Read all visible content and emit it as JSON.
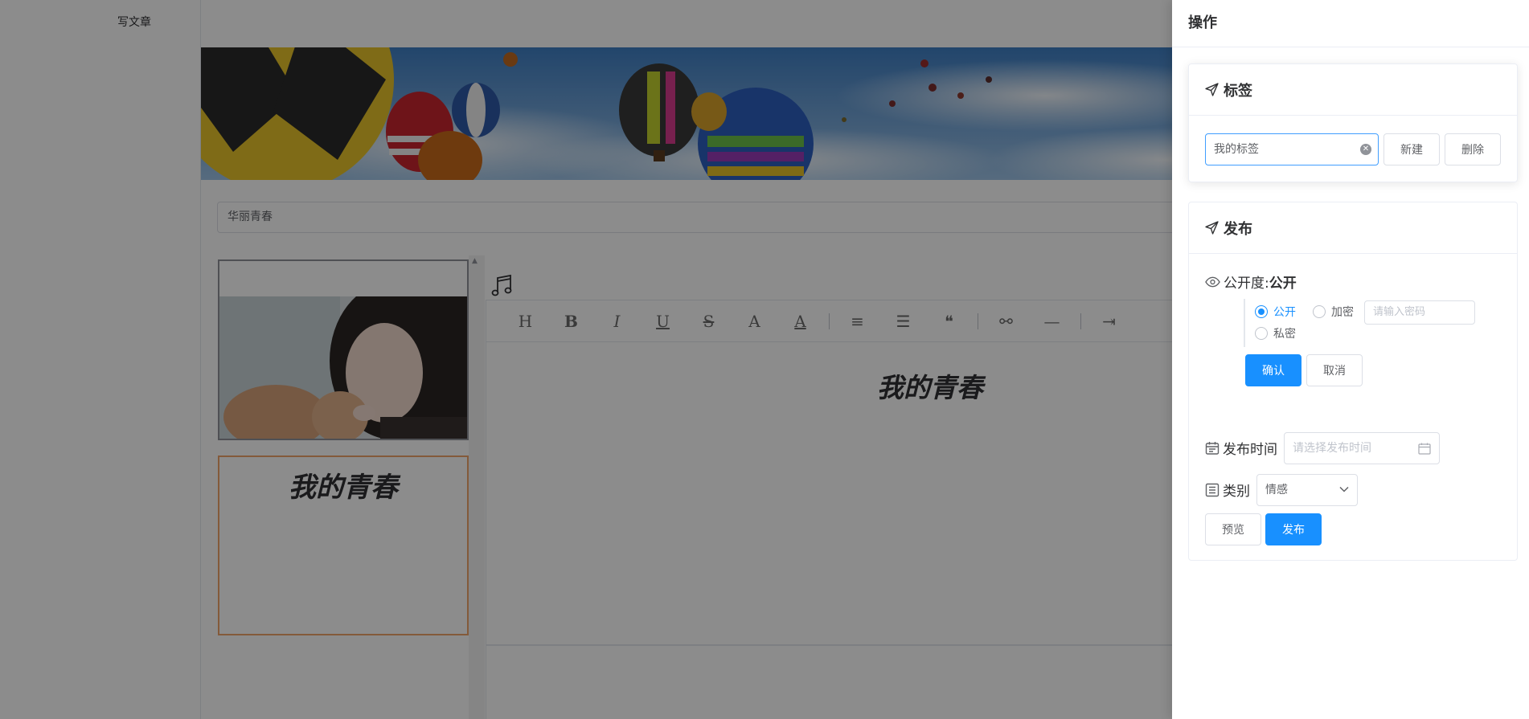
{
  "page": {
    "breadcrumb": "写文章",
    "title_input_value": "华丽青春",
    "preview_title": "我的青春",
    "editor_heading": "我的青春",
    "toolbar": [
      {
        "icon": "heading-icon",
        "glyph": "H"
      },
      {
        "icon": "bold-icon",
        "glyph": "B"
      },
      {
        "icon": "italic-icon",
        "glyph": "I"
      },
      {
        "icon": "underline-icon",
        "glyph": "U"
      },
      {
        "icon": "strikethrough-icon",
        "glyph": "S"
      },
      {
        "icon": "font-size-icon",
        "glyph": "A"
      },
      {
        "icon": "font-color-icon",
        "glyph": "A"
      },
      {
        "icon": "ordered-list-icon",
        "glyph": "≡"
      },
      {
        "icon": "unordered-list-icon",
        "glyph": "☰"
      },
      {
        "icon": "quote-icon",
        "glyph": "❝"
      },
      {
        "icon": "link-icon",
        "glyph": "⚯"
      },
      {
        "icon": "horizontal-rule-icon",
        "glyph": "—"
      },
      {
        "icon": "indent-icon",
        "glyph": "⇥"
      }
    ]
  },
  "drawer": {
    "title": "操作",
    "tags": {
      "heading": "标签",
      "input_value": "我的标签",
      "new_button": "新建",
      "delete_button": "删除"
    },
    "publish": {
      "heading": "发布",
      "visibility_label": "公开度:",
      "visibility_value": "公开",
      "options": {
        "public": "公开",
        "encrypted": "加密",
        "private": "私密"
      },
      "selected_option": "公开",
      "password_placeholder": "请输入密码",
      "confirm_button": "确认",
      "cancel_button": "取消",
      "time_label": "发布时间",
      "time_placeholder": "请选择发布时间",
      "category_label": "类别",
      "category_value": "情感",
      "preview_button": "预览",
      "publish_button": "发布"
    }
  },
  "colors": {
    "primary": "#1890ff",
    "mask": "rgba(0,0,0,0.45)",
    "preview_frame_border": "#f0a46a"
  }
}
